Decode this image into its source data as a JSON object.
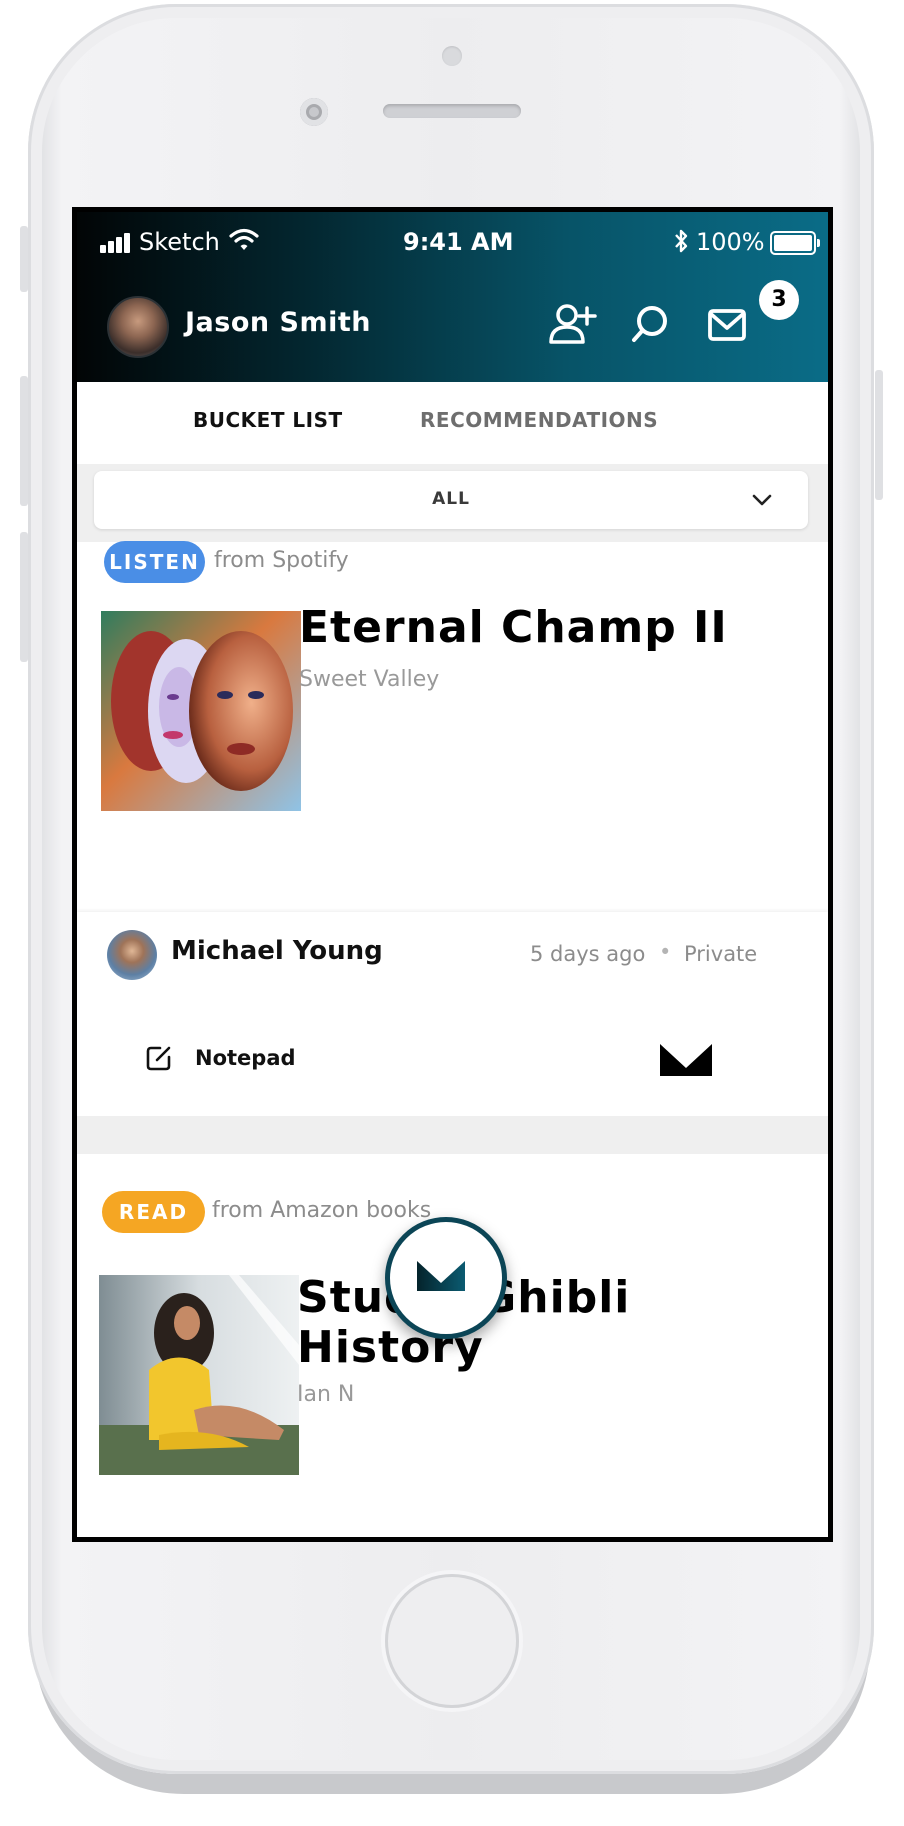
{
  "status_bar": {
    "carrier": "Sketch",
    "time": "9:41 AM",
    "battery": "100%"
  },
  "header": {
    "user_name": "Jason Smith",
    "inbox_count": "3",
    "icons": [
      "add-user-icon",
      "search-icon",
      "mail-icon"
    ]
  },
  "tabs": [
    {
      "label": "BUCKET LIST",
      "active": true
    },
    {
      "label": "RECOMMENDATIONS",
      "active": false
    }
  ],
  "filter": {
    "selected": "ALL"
  },
  "cards": [
    {
      "type_label": "LISTEN",
      "type_color": "#4a8ee6",
      "source": "from Spotify",
      "title": "Eternal Champ II",
      "subtitle": "Sweet Valley",
      "shared_by": "Michael Young",
      "time_ago": "5 days ago",
      "separator": "•",
      "visibility": "Private",
      "notepad_label": "Notepad"
    },
    {
      "type_label": "READ",
      "type_color": "#f5a623",
      "source": "from Amazon books",
      "title_line1": "Studio Ghibli",
      "title_line2": "History",
      "subtitle": "Ian N"
    }
  ]
}
